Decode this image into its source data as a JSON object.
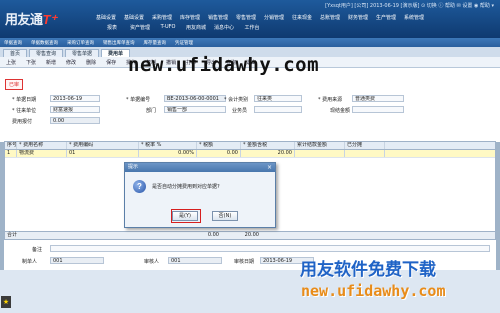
{
  "app": {
    "logo_main": "用友通",
    "logo_suffix": "T⁺",
    "top_info": "[Yxsqt用户]  [公司]  2013-06-19  [演示版]   ⊙ 切换  ⓘ 帮助  ✉ 设置  ◉ 帮助 ▾"
  },
  "menu": {
    "row1": [
      "基础设置",
      "基础设置",
      "采购管理",
      "库存管理",
      "销售管理",
      "零售管理",
      "分销管理",
      "往来现金",
      "总账管理",
      "财务管理",
      "生产管理",
      "系统管理"
    ],
    "row2": [
      "报表",
      "资产管理",
      "T-UFO",
      "用友商城",
      "消息中心",
      "工作台"
    ]
  },
  "nav_tabs": [
    "单据查询",
    "单据数据查询",
    "采购订单查询",
    "销售出库单查询",
    "库存量查询",
    "凭证管理"
  ],
  "doc_tabs": [
    "首页",
    "零售查询",
    "零售单据",
    "费用单"
  ],
  "toolbar": [
    "上张",
    "下张",
    "新增",
    "修改",
    "删除",
    "保存",
    "操作",
    "复制",
    "撤销",
    "打印",
    "导出",
    "查询",
    "退出"
  ],
  "form": {
    "stamp": "已审",
    "date_label": "* 单据日期",
    "date_value": "2013-06-19",
    "code_label": "* 单据编号",
    "code_value": "BE-2013-06-00-0001",
    "unit_label": "* 往来单位",
    "unit_value": "财富速报",
    "dept_label": "部门",
    "dept_value": "销售一部",
    "salesman_label": "业务员",
    "salesman_value": "",
    "amount_label": "费用报付",
    "amount_value": "0.00",
    "currency_label": "* 会计类别",
    "currency_value": "往来类",
    "settle_label": "* 费用来源",
    "settle_value": "普通类费",
    "cash_label": "现结金额",
    "cash_value": ""
  },
  "watermark_url": "new.ufidawhy.com",
  "grid": {
    "headers": [
      "序号",
      "* 费用名称",
      "* 费用编码",
      "* 税率 %",
      "* 税额",
      "* 金额含税",
      "累计结款金额",
      "已分摊"
    ],
    "row1": [
      "1",
      "物流费",
      "01",
      "0.00%",
      "0.00",
      "20.00",
      "",
      ""
    ],
    "sum_label": "合计",
    "sum_tax": "0.00",
    "sum_amount": "20.00"
  },
  "footer": {
    "remark_label": "备注",
    "maker_label": "制单人",
    "maker_value": "001",
    "auditor_label": "审核人",
    "auditor_value": "001",
    "audit_date_label": "审核日期",
    "audit_date_value": "2013-06-19"
  },
  "dialog": {
    "title": "提示",
    "message": "是否自动分摊费用到对应单据?",
    "ok_label": "是(Y)",
    "no_label": "否(N)"
  },
  "watermark": {
    "cn": "用友软件免费下载",
    "url": "new.ufidawhy.com"
  }
}
